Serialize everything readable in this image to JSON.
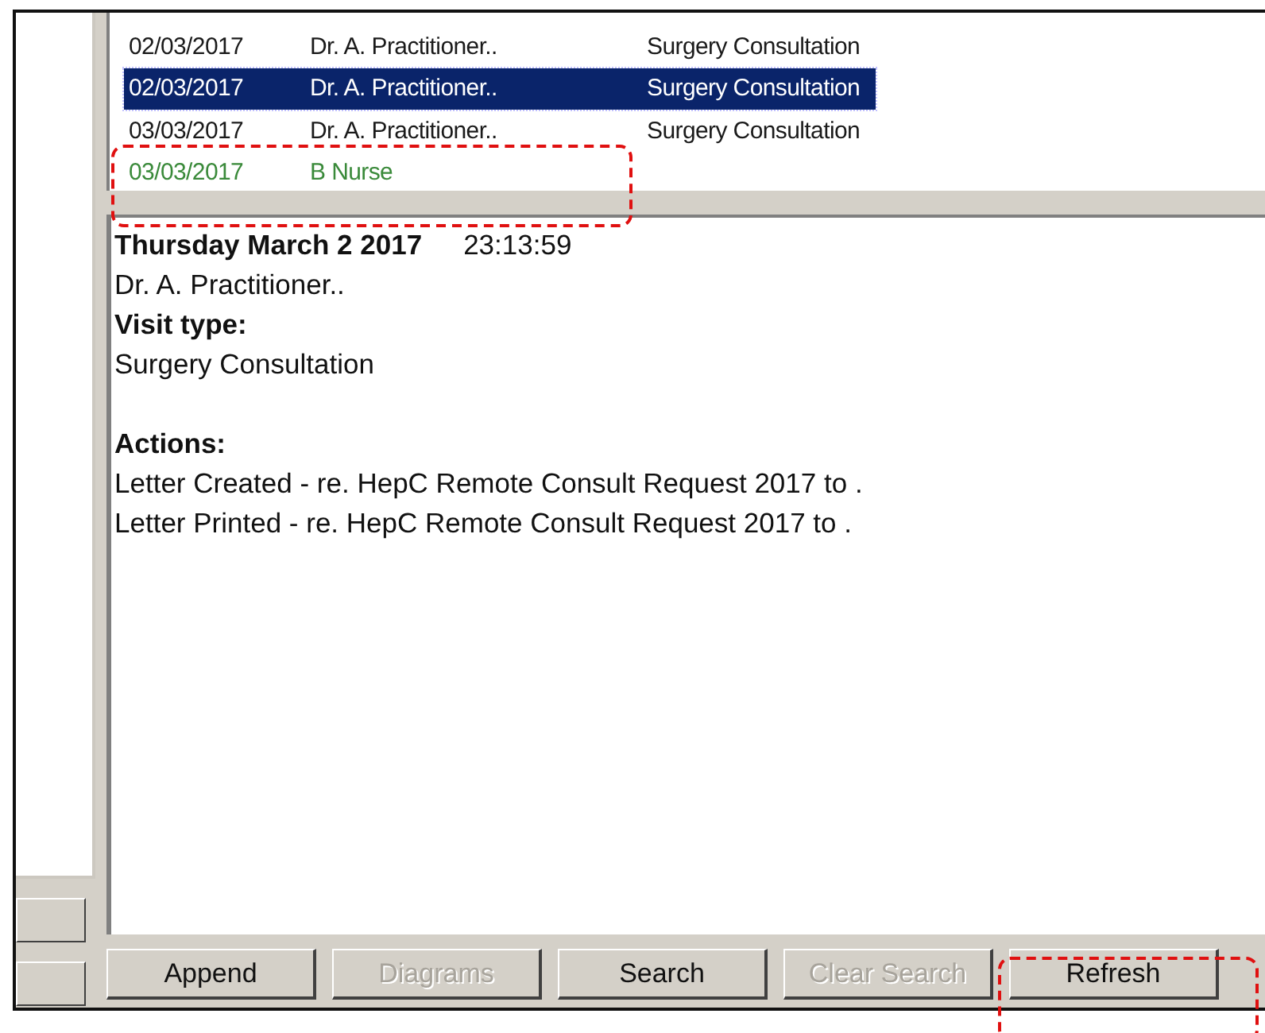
{
  "visits": {
    "rows": [
      {
        "date": "02/03/2017",
        "clinician": "Dr. A. Practitioner..",
        "visit_type": "Surgery Consultation",
        "selected": false,
        "color": "#1a1a1a"
      },
      {
        "date": "02/03/2017",
        "clinician": "Dr. A. Practitioner..",
        "visit_type": "Surgery Consultation",
        "selected": true
      },
      {
        "date": "03/03/2017",
        "clinician": "Dr. A. Practitioner..",
        "visit_type": "Surgery Consultation",
        "selected": false,
        "color": "#1a1a1a"
      },
      {
        "date": "03/03/2017",
        "clinician": "B Nurse",
        "selected": false,
        "color": "#3a8a3a"
      }
    ]
  },
  "detail": {
    "date": "Thursday March 2 2017",
    "time": "23:13:59",
    "clinician": "Dr. A. Practitioner..",
    "visit_type_label": "Visit type:",
    "visit_type": "Surgery Consultation",
    "actions_label": "Actions:",
    "actions": [
      "Letter Created - re. HepC Remote Consult Request 2017 to .",
      "Letter Printed - re. HepC Remote Consult Request 2017 to ."
    ]
  },
  "buttons": [
    {
      "label": "Append",
      "disabled": false
    },
    {
      "label": "Diagrams",
      "disabled": true
    },
    {
      "label": "Search",
      "disabled": false
    },
    {
      "label": "Clear Search",
      "disabled": true
    },
    {
      "label": "Refresh",
      "disabled": false
    }
  ]
}
